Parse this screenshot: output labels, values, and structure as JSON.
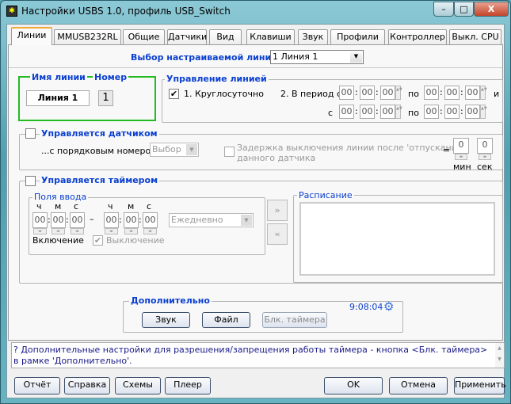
{
  "window": {
    "title": "Настройки USBS 1.0, профиль USB_Switch",
    "controls": {
      "minimize": "–",
      "maximize": "□",
      "close": "X"
    }
  },
  "tabs": [
    {
      "label": "Линии",
      "selected": true
    },
    {
      "label": "MMUSB232RL"
    },
    {
      "label": "Общие"
    },
    {
      "label": "Датчики"
    },
    {
      "label": "Вид"
    },
    {
      "label": "Клавиши"
    },
    {
      "label": "Звук"
    },
    {
      "label": "Профили"
    },
    {
      "label": "Контроллер"
    },
    {
      "label": "Выкл. CPU"
    }
  ],
  "line_select": {
    "label": "Выбор настраиваемой линии",
    "value": "1 Линия 1"
  },
  "line_name": {
    "name_label": "Имя линии",
    "number_label": "Номер",
    "name": "Линия 1",
    "number": "1"
  },
  "line_control": {
    "title": "Управление линией",
    "around_clock": "1. Круглосуточно",
    "around_clock_checked": true,
    "period_label": "2. В период с",
    "to": "по",
    "and": "и",
    "from": "с",
    "times": [
      "00",
      "00",
      "00",
      "00",
      "00",
      "00",
      "00",
      "00",
      "00",
      "00",
      "00",
      "00"
    ]
  },
  "sensor": {
    "title": "Управляется датчиком",
    "checked": false,
    "number_label": "...с порядковым номером",
    "number_value": "Выбор",
    "delay_label_1": "Задержка выключения линии после 'отпускания'",
    "delay_label_2": "данного датчика",
    "equals": "=",
    "min": "0",
    "sec": "0",
    "min_label": "мин",
    "sec_label": "сек"
  },
  "timer": {
    "title": "Управляется таймером",
    "checked": false,
    "inputs_title": "Поля ввода",
    "h": "ч",
    "m": "м",
    "s": "с",
    "dash": "–",
    "times": [
      "00",
      "00",
      "00",
      "00",
      "00",
      "00"
    ],
    "repeat": "Ежедневно",
    "on_label": "Включение",
    "off_label": "Выключение",
    "off_checked": true,
    "schedule_title": "Расписание"
  },
  "extra": {
    "title": "Дополнительно",
    "clock": "9:08:04",
    "sound": "Звук",
    "file": "Файл",
    "block_timer": "Блк. таймера"
  },
  "hint": "? Дополнительные настройки для разрешения/запрещения работы таймера - кнопка <Блк. таймера> в рамке 'Дополнительно'.",
  "buttons": {
    "report": "Отчёт",
    "help": "Справка",
    "schemes": "Схемы",
    "player": "Плеер",
    "ok": "OK",
    "cancel": "Отмена",
    "apply": "Применить"
  },
  "colors": {
    "accent": "#0a3fd0",
    "name_frame": "#22bb22"
  }
}
